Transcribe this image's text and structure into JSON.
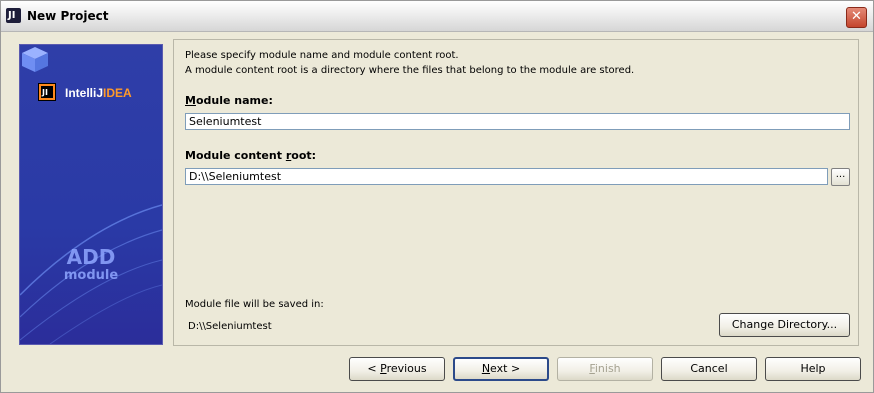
{
  "window": {
    "title": "New Project",
    "close_glyph": "✕",
    "app_icon": "intellij-icon"
  },
  "banner": {
    "logo_prefix": "IntelliJ",
    "logo_suffix": "IDEA",
    "add_text": "ADD",
    "module_text": "module",
    "bg_color": "#2f3ea8"
  },
  "form": {
    "description_line1": "Please specify module name and module content root.",
    "description_line2": "A module content root is a directory where the files that belong to the module are stored.",
    "module_name_label_mnemonic": "M",
    "module_name_label_rest": "odule name:",
    "module_name_value": "Seleniumtest",
    "content_root_label_pre": "Module content ",
    "content_root_label_mnemonic": "r",
    "content_root_label_post": "oot:",
    "content_root_value": "D:\\\\Seleniumtest",
    "browse_label": "...",
    "save_info_label": "Module file will be saved in:",
    "save_path": "D:\\\\Seleniumtest",
    "change_directory_label": "Change Directory..."
  },
  "buttons": {
    "previous_pre": "< ",
    "previous_mnemonic": "P",
    "previous_post": "revious",
    "next_mnemonic": "N",
    "next_post": "ext >",
    "finish_mnemonic": "F",
    "finish_post": "inish",
    "cancel": "Cancel",
    "help": "Help"
  }
}
